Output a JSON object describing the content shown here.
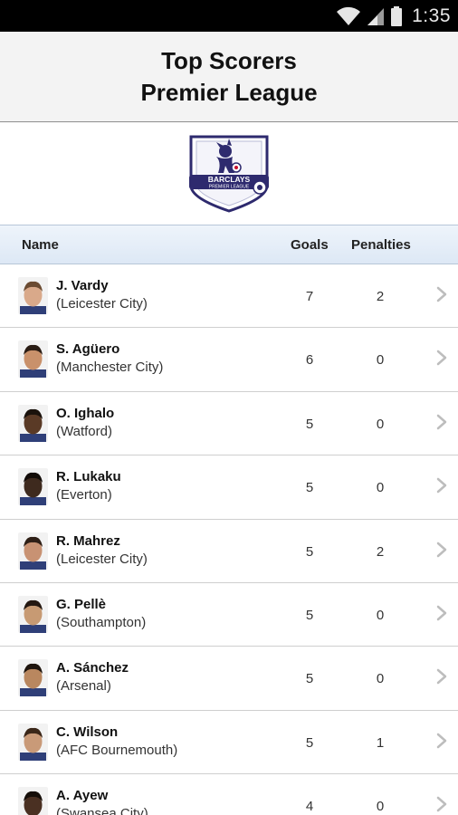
{
  "status_bar": {
    "time": "1:35",
    "icons": [
      "wifi-icon",
      "signal-icon",
      "battery-icon"
    ]
  },
  "header": {
    "title_line1": "Top Scorers",
    "title_line2": "Premier League"
  },
  "logo": {
    "text_main": "BARCLAYS",
    "text_sub": "PREMIER LEAGUE"
  },
  "table": {
    "headers": {
      "name": "Name",
      "goals": "Goals",
      "penalties": "Penalties"
    },
    "rows": [
      {
        "name": "J. Vardy",
        "club": "(Leicester City)",
        "goals": "7",
        "penalties": "2",
        "skin": "#d9a98a",
        "hair": "#6b4b32"
      },
      {
        "name": "S. Agüero",
        "club": "(Manchester City)",
        "goals": "6",
        "penalties": "0",
        "skin": "#c9916b",
        "hair": "#2a1c14"
      },
      {
        "name": "O. Ighalo",
        "club": "(Watford)",
        "goals": "5",
        "penalties": "0",
        "skin": "#5a3a26",
        "hair": "#1a120c"
      },
      {
        "name": "R. Lukaku",
        "club": "(Everton)",
        "goals": "5",
        "penalties": "0",
        "skin": "#3e2a1e",
        "hair": "#120c08"
      },
      {
        "name": "R. Mahrez",
        "club": "(Leicester City)",
        "goals": "5",
        "penalties": "2",
        "skin": "#c89273",
        "hair": "#2e1f16"
      },
      {
        "name": "G. Pellè",
        "club": "(Southampton)",
        "goals": "5",
        "penalties": "0",
        "skin": "#c79a73",
        "hair": "#241811"
      },
      {
        "name": "A. Sánchez",
        "club": "(Arsenal)",
        "goals": "5",
        "penalties": "0",
        "skin": "#b9875f",
        "hair": "#1e140d"
      },
      {
        "name": "C. Wilson",
        "club": "(AFC Bournemouth)",
        "goals": "5",
        "penalties": "1",
        "skin": "#c99a78",
        "hair": "#3a2618"
      },
      {
        "name": "A. Ayew",
        "club": "(Swansea City)",
        "goals": "4",
        "penalties": "0",
        "skin": "#4a3022",
        "hair": "#150e09"
      }
    ]
  }
}
